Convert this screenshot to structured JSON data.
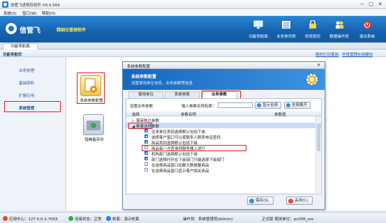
{
  "window": {
    "title": "信管飞进销存软件 V9.4.584"
  },
  "menu": [
    "系统(S)",
    "窗口(W)",
    "帮助(H)"
  ],
  "brand": {
    "name": "信管飞",
    "slogan": "精细化管理软件"
  },
  "toolbar": [
    {
      "label": "功能导航面",
      "icon": "monitor-icon"
    },
    {
      "label": "业务单列表",
      "icon": "list-icon"
    },
    {
      "label": "修改密码",
      "icon": "lock-icon"
    },
    {
      "label": "数据操作员",
      "icon": "users-icon"
    },
    {
      "label": "退出系统",
      "icon": "power-icon"
    }
  ],
  "tabs": {
    "home": "功能导航面"
  },
  "nav": {
    "title": "功能导航栏",
    "links": [
      "随时打印使用",
      "学员管理在线模块"
    ],
    "items": [
      "业务处理",
      "基础资料",
      "扩展应用",
      "系统管理"
    ]
  },
  "modules": [
    {
      "label": "系统参数配置",
      "icon": "settings-doc-icon"
    },
    {
      "label": "错峰备存份",
      "icon": "disk-icon"
    }
  ],
  "dialog": {
    "title": "系统参数配置",
    "banner_title": "系统参数配置",
    "banner_subtitle": "设置使用单位信息，业务参数等信息",
    "tabs": [
      "使用单位",
      "系统参数",
      "业务参数"
    ],
    "active_tab": 2,
    "toolbar": {
      "left_label": "设置业务参数",
      "search_label": "输入参数名称检索：",
      "search_value": "",
      "show_all": "显示全部",
      "expand_all": "全部展开"
    },
    "columns": [
      "选择",
      "参数名称",
      "参数值"
    ],
    "rows": [
      {
        "type": "group",
        "text": "▷ 需审核过参数",
        "checked": false
      },
      {
        "type": "group-open",
        "text": "◢ 数量选择参数",
        "checked": false
      },
      {
        "type": "item",
        "text": "往来单位类别选择默认包括下级",
        "checked": true
      },
      {
        "type": "item",
        "text": "选择客户窗口可以按联系人联系电话查找",
        "checked": true
      },
      {
        "type": "item",
        "text": "商品类别选择默认包括下级",
        "checked": true
      },
      {
        "type": "item",
        "text": "商品每一次查询到服务器上进行",
        "checked": false
      },
      {
        "type": "item",
        "text": "机构部门选择默认包括下级",
        "checked": true
      },
      {
        "type": "item",
        "text": "部门选择时存在下级部门只能选择下级部门",
        "checked": true
      },
      {
        "type": "item",
        "text": "在选择商品窗口加载大数据量商品",
        "checked": false
      },
      {
        "type": "item",
        "text": "在选择商品窗口显示客户相关商品",
        "checked": false
      }
    ],
    "buttons": {
      "save": "保存(S)",
      "close": "关闭(C)"
    }
  },
  "status": {
    "app_center": "应用中心：127.0.0.1:7093",
    "conn": "连接状态：正常",
    "account": "帐套：演示帐套",
    "operator": "操作员：系统管理员(Admin)",
    "version": "正式版 使用单位：pc006_zss"
  }
}
